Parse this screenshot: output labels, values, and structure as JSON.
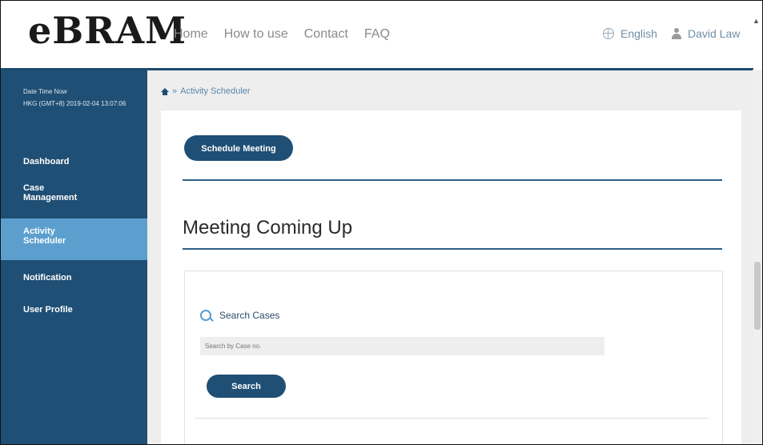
{
  "app": {
    "logo": "eBRAM",
    "nav": [
      "Home",
      "How to use",
      "Contact",
      "FAQ"
    ],
    "language": "English",
    "user": "David Law"
  },
  "sidebar": {
    "datetime_title": "Date Time Now",
    "datetime_value": "HKG (GMT+8) 2019-02-04 13:07:06",
    "items": [
      {
        "label": "Dashboard"
      },
      {
        "label": "Case Management"
      },
      {
        "label": "Activity Scheduler"
      },
      {
        "label": "Notification"
      },
      {
        "label": "User Profile"
      }
    ]
  },
  "breadcrumb": {
    "separator": "»",
    "current": "Activity Scheduler"
  },
  "main": {
    "schedule_button": "Schedule Meeting",
    "heading": "Meeting Coming Up",
    "search": {
      "label": "Search Cases",
      "placeholder": "Search by Case no.",
      "button": "Search"
    }
  },
  "colors": {
    "brand": "#1f4f75",
    "active": "#5c9fce",
    "accent": "#5a9bd0"
  }
}
